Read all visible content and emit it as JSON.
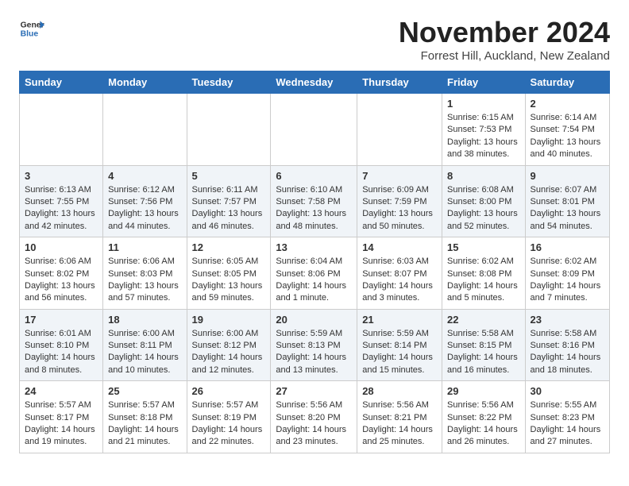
{
  "header": {
    "logo_line1": "General",
    "logo_line2": "Blue",
    "month": "November 2024",
    "location": "Forrest Hill, Auckland, New Zealand"
  },
  "days_of_week": [
    "Sunday",
    "Monday",
    "Tuesday",
    "Wednesday",
    "Thursday",
    "Friday",
    "Saturday"
  ],
  "weeks": [
    {
      "shade": false,
      "days": [
        {
          "num": "",
          "info": ""
        },
        {
          "num": "",
          "info": ""
        },
        {
          "num": "",
          "info": ""
        },
        {
          "num": "",
          "info": ""
        },
        {
          "num": "",
          "info": ""
        },
        {
          "num": "1",
          "info": "Sunrise: 6:15 AM\nSunset: 7:53 PM\nDaylight: 13 hours\nand 38 minutes."
        },
        {
          "num": "2",
          "info": "Sunrise: 6:14 AM\nSunset: 7:54 PM\nDaylight: 13 hours\nand 40 minutes."
        }
      ]
    },
    {
      "shade": true,
      "days": [
        {
          "num": "3",
          "info": "Sunrise: 6:13 AM\nSunset: 7:55 PM\nDaylight: 13 hours\nand 42 minutes."
        },
        {
          "num": "4",
          "info": "Sunrise: 6:12 AM\nSunset: 7:56 PM\nDaylight: 13 hours\nand 44 minutes."
        },
        {
          "num": "5",
          "info": "Sunrise: 6:11 AM\nSunset: 7:57 PM\nDaylight: 13 hours\nand 46 minutes."
        },
        {
          "num": "6",
          "info": "Sunrise: 6:10 AM\nSunset: 7:58 PM\nDaylight: 13 hours\nand 48 minutes."
        },
        {
          "num": "7",
          "info": "Sunrise: 6:09 AM\nSunset: 7:59 PM\nDaylight: 13 hours\nand 50 minutes."
        },
        {
          "num": "8",
          "info": "Sunrise: 6:08 AM\nSunset: 8:00 PM\nDaylight: 13 hours\nand 52 minutes."
        },
        {
          "num": "9",
          "info": "Sunrise: 6:07 AM\nSunset: 8:01 PM\nDaylight: 13 hours\nand 54 minutes."
        }
      ]
    },
    {
      "shade": false,
      "days": [
        {
          "num": "10",
          "info": "Sunrise: 6:06 AM\nSunset: 8:02 PM\nDaylight: 13 hours\nand 56 minutes."
        },
        {
          "num": "11",
          "info": "Sunrise: 6:06 AM\nSunset: 8:03 PM\nDaylight: 13 hours\nand 57 minutes."
        },
        {
          "num": "12",
          "info": "Sunrise: 6:05 AM\nSunset: 8:05 PM\nDaylight: 13 hours\nand 59 minutes."
        },
        {
          "num": "13",
          "info": "Sunrise: 6:04 AM\nSunset: 8:06 PM\nDaylight: 14 hours\nand 1 minute."
        },
        {
          "num": "14",
          "info": "Sunrise: 6:03 AM\nSunset: 8:07 PM\nDaylight: 14 hours\nand 3 minutes."
        },
        {
          "num": "15",
          "info": "Sunrise: 6:02 AM\nSunset: 8:08 PM\nDaylight: 14 hours\nand 5 minutes."
        },
        {
          "num": "16",
          "info": "Sunrise: 6:02 AM\nSunset: 8:09 PM\nDaylight: 14 hours\nand 7 minutes."
        }
      ]
    },
    {
      "shade": true,
      "days": [
        {
          "num": "17",
          "info": "Sunrise: 6:01 AM\nSunset: 8:10 PM\nDaylight: 14 hours\nand 8 minutes."
        },
        {
          "num": "18",
          "info": "Sunrise: 6:00 AM\nSunset: 8:11 PM\nDaylight: 14 hours\nand 10 minutes."
        },
        {
          "num": "19",
          "info": "Sunrise: 6:00 AM\nSunset: 8:12 PM\nDaylight: 14 hours\nand 12 minutes."
        },
        {
          "num": "20",
          "info": "Sunrise: 5:59 AM\nSunset: 8:13 PM\nDaylight: 14 hours\nand 13 minutes."
        },
        {
          "num": "21",
          "info": "Sunrise: 5:59 AM\nSunset: 8:14 PM\nDaylight: 14 hours\nand 15 minutes."
        },
        {
          "num": "22",
          "info": "Sunrise: 5:58 AM\nSunset: 8:15 PM\nDaylight: 14 hours\nand 16 minutes."
        },
        {
          "num": "23",
          "info": "Sunrise: 5:58 AM\nSunset: 8:16 PM\nDaylight: 14 hours\nand 18 minutes."
        }
      ]
    },
    {
      "shade": false,
      "days": [
        {
          "num": "24",
          "info": "Sunrise: 5:57 AM\nSunset: 8:17 PM\nDaylight: 14 hours\nand 19 minutes."
        },
        {
          "num": "25",
          "info": "Sunrise: 5:57 AM\nSunset: 8:18 PM\nDaylight: 14 hours\nand 21 minutes."
        },
        {
          "num": "26",
          "info": "Sunrise: 5:57 AM\nSunset: 8:19 PM\nDaylight: 14 hours\nand 22 minutes."
        },
        {
          "num": "27",
          "info": "Sunrise: 5:56 AM\nSunset: 8:20 PM\nDaylight: 14 hours\nand 23 minutes."
        },
        {
          "num": "28",
          "info": "Sunrise: 5:56 AM\nSunset: 8:21 PM\nDaylight: 14 hours\nand 25 minutes."
        },
        {
          "num": "29",
          "info": "Sunrise: 5:56 AM\nSunset: 8:22 PM\nDaylight: 14 hours\nand 26 minutes."
        },
        {
          "num": "30",
          "info": "Sunrise: 5:55 AM\nSunset: 8:23 PM\nDaylight: 14 hours\nand 27 minutes."
        }
      ]
    }
  ]
}
